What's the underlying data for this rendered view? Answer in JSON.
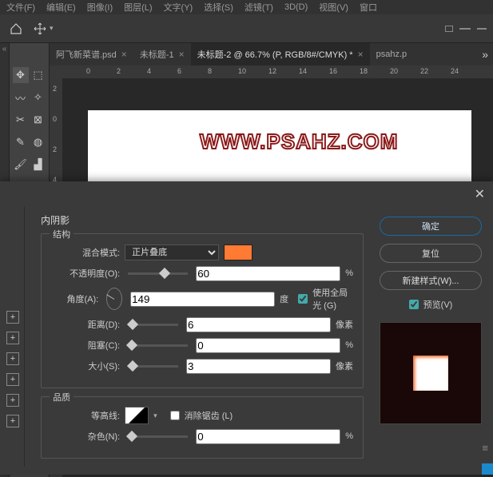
{
  "menu": {
    "items": [
      "文件(F)",
      "编辑(E)",
      "图像(I)",
      "图层(L)",
      "文字(Y)",
      "选择(S)",
      "滤镜(T)",
      "3D(D)",
      "视图(V)",
      "窗口"
    ]
  },
  "tabs": [
    {
      "label": "阿飞新菜谱.psd",
      "active": false
    },
    {
      "label": "未标题-1",
      "active": false
    },
    {
      "label": "未标题-2 @ 66.7% (P, RGB/8#/CMYK) *",
      "active": true
    },
    {
      "label": "psahz.p",
      "active": false
    }
  ],
  "ruler_h": [
    "0",
    "2",
    "4",
    "6",
    "8",
    "10",
    "12",
    "14",
    "16",
    "18",
    "20",
    "22",
    "24"
  ],
  "ruler_v": [
    "2",
    "0",
    "2",
    "4"
  ],
  "watermark": "WWW.PSAHZ.COM",
  "dialog": {
    "section": "内阴影",
    "group_structure": "结构",
    "group_quality": "品质",
    "blend_label": "混合模式:",
    "blend_value": "正片叠底",
    "opacity_label": "不透明度(O):",
    "opacity_value": "60",
    "pct": "%",
    "angle_label": "角度(A):",
    "angle_value": "149",
    "deg": "度",
    "global_label": "使用全局光 (G)",
    "distance_label": "距离(D):",
    "distance_value": "6",
    "px": "像素",
    "choke_label": "阻塞(C):",
    "choke_value": "0",
    "size_label": "大小(S):",
    "size_value": "3",
    "contour_label": "等高线:",
    "antialias_label": "消除锯齿 (L)",
    "noise_label": "杂色(N):",
    "noise_value": "0",
    "swatch_color": "#ff7a33"
  },
  "buttons": {
    "ok": "确定",
    "reset": "复位",
    "newstyle": "新建样式(W)...",
    "preview": "预览(V)"
  }
}
